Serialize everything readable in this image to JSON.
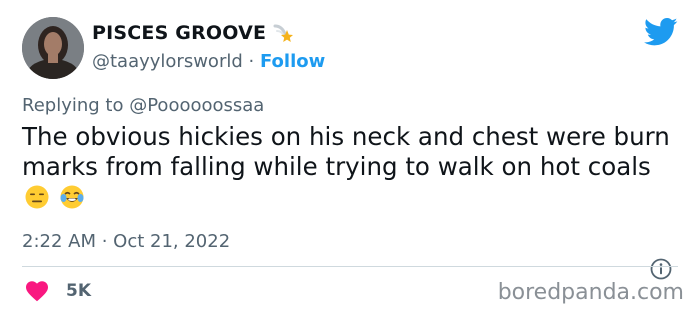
{
  "author": {
    "display_name": "PISCES GROOVE",
    "handle": "@taayylorsworld",
    "separator": "·",
    "follow_label": "Follow"
  },
  "reply": {
    "prefix": "Replying to",
    "handle": "@Poooooossaa"
  },
  "tweet": {
    "text": "The obvious hickies on his neck and chest were burn marks from falling while trying to walk on hot coals",
    "emojis": [
      "expressionless-face",
      "tears-of-joy-face"
    ],
    "timestamp": "2:22 AM · Oct 21, 2022"
  },
  "stats": {
    "likes": "5K"
  },
  "watermark": "boredpanda.com",
  "colors": {
    "accent": "#1d9bf0",
    "heart": "#f91880",
    "secondary_text": "#536471"
  }
}
